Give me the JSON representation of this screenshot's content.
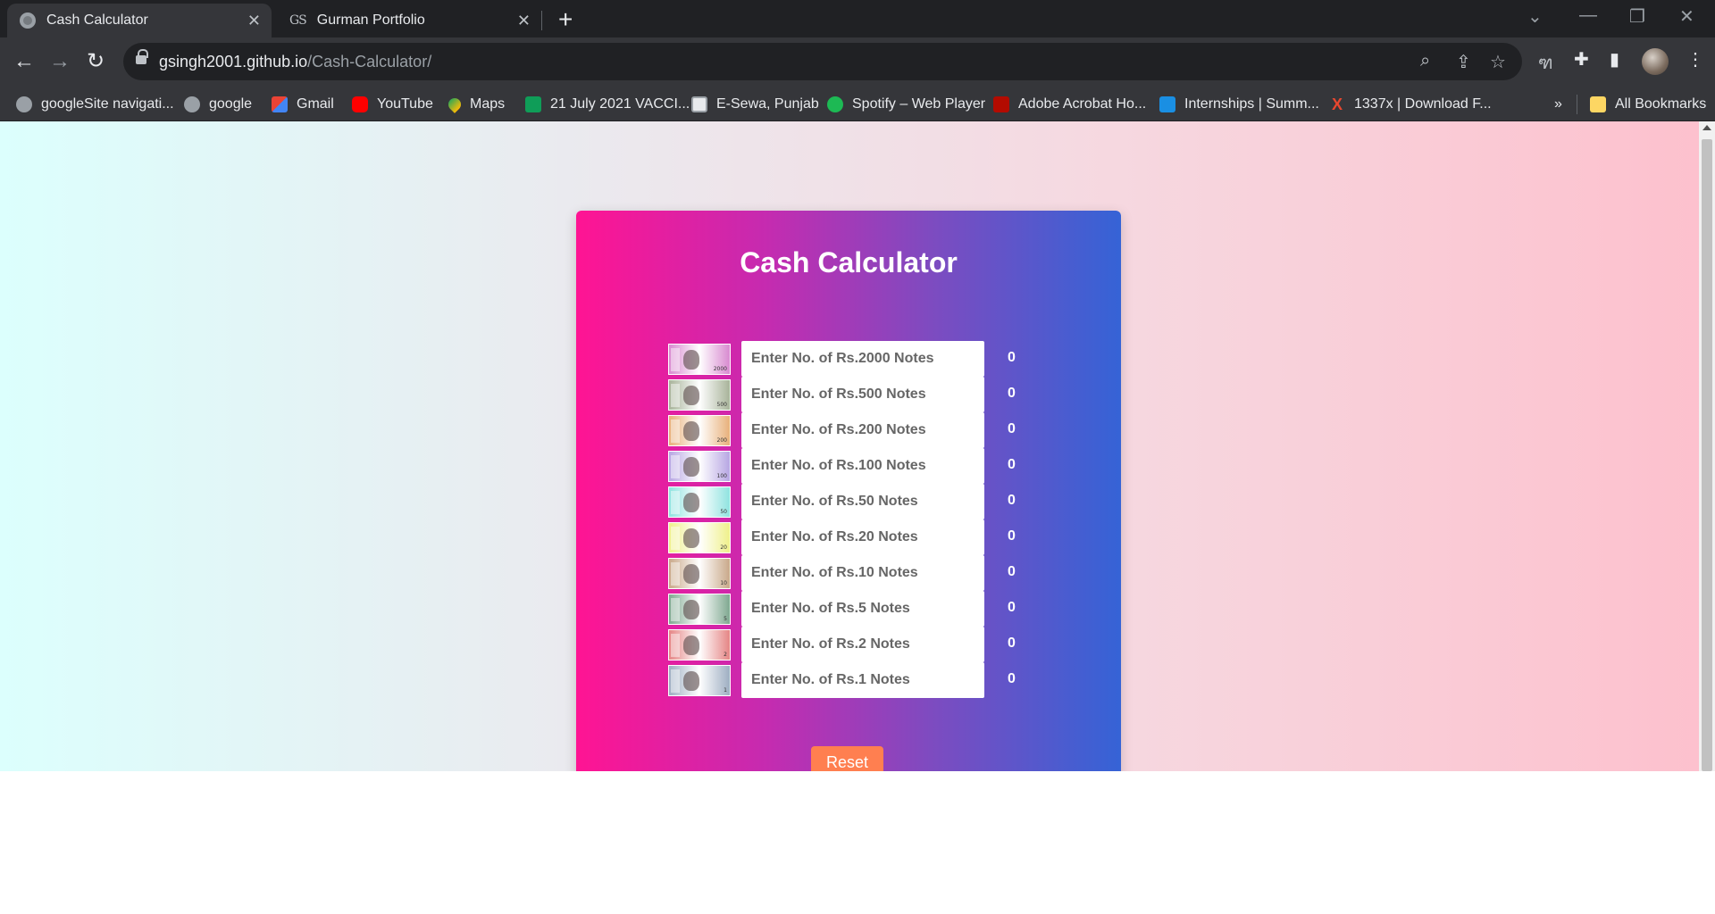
{
  "browser": {
    "tabs": [
      {
        "title": "Cash Calculator",
        "favicon": "globe-icon",
        "active": true
      },
      {
        "title": "Gurman Portfolio",
        "favicon": "GS",
        "active": false
      }
    ],
    "url_host": "gsingh2001.github.io",
    "url_path": "/Cash-Calculator/",
    "bookmarks": [
      {
        "label": "googleSite navigati...",
        "icon": "globe-icon"
      },
      {
        "label": "google",
        "icon": "globe-icon"
      },
      {
        "label": "Gmail",
        "icon": "gmail-icon"
      },
      {
        "label": "YouTube",
        "icon": "youtube-icon"
      },
      {
        "label": "Maps",
        "icon": "maps-icon"
      },
      {
        "label": "21 July 2021 VACCI...",
        "icon": "sheets-icon"
      },
      {
        "label": "E-Sewa, Punjab",
        "icon": "esewa-icon"
      },
      {
        "label": "Spotify – Web Player",
        "icon": "spotify-icon"
      },
      {
        "label": "Adobe Acrobat Ho...",
        "icon": "adobe-icon"
      },
      {
        "label": "Internships | Summ...",
        "icon": "internshala-icon"
      },
      {
        "label": "1337x | Download F...",
        "icon": "1337x-icon"
      }
    ],
    "bookmarks_overflow": "»",
    "all_bookmarks": "All Bookmarks"
  },
  "app": {
    "title": "Cash Calculator",
    "rows": [
      {
        "denomination": "2000",
        "placeholder": "Enter No. of Rs.2000 Notes",
        "total": "0",
        "note_color": "#d88ad0"
      },
      {
        "denomination": "500",
        "placeholder": "Enter No. of Rs.500 Notes",
        "total": "0",
        "note_color": "#a8b39a"
      },
      {
        "denomination": "200",
        "placeholder": "Enter No. of Rs.200 Notes",
        "total": "0",
        "note_color": "#e8b07a"
      },
      {
        "denomination": "100",
        "placeholder": "Enter No. of Rs.100 Notes",
        "total": "0",
        "note_color": "#b7a6e3"
      },
      {
        "denomination": "50",
        "placeholder": "Enter No. of Rs.50 Notes",
        "total": "0",
        "note_color": "#8fe3e0"
      },
      {
        "denomination": "20",
        "placeholder": "Enter No. of Rs.20 Notes",
        "total": "0",
        "note_color": "#eff08a"
      },
      {
        "denomination": "10",
        "placeholder": "Enter No. of Rs.10 Notes",
        "total": "0",
        "note_color": "#c9a889"
      },
      {
        "denomination": "5",
        "placeholder": "Enter No. of Rs.5 Notes",
        "total": "0",
        "note_color": "#7fa890"
      },
      {
        "denomination": "2",
        "placeholder": "Enter No. of Rs.2 Notes",
        "total": "0",
        "note_color": "#e58585"
      },
      {
        "denomination": "1",
        "placeholder": "Enter No. of Rs.1 Notes",
        "total": "0",
        "note_color": "#9eaec2"
      }
    ],
    "reset_label": "Reset"
  },
  "colors": {
    "card_gradient_start": "#ff1493",
    "card_gradient_end": "#3563d6",
    "reset_button": "#ff7f50"
  }
}
